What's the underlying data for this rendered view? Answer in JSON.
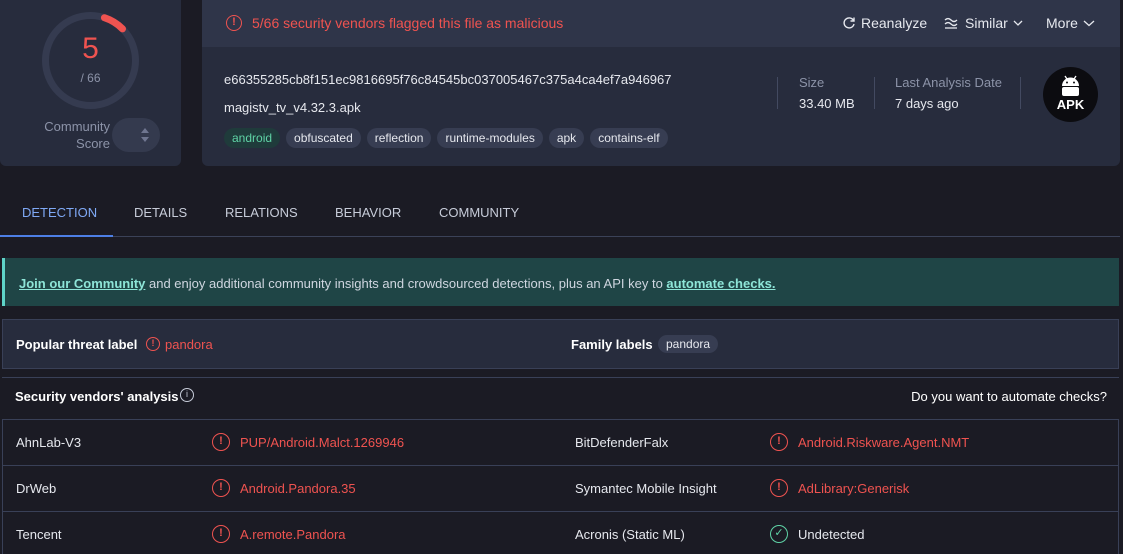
{
  "score": {
    "detections": "5",
    "total": "/ 66",
    "fraction": 0.076,
    "community_label_1": "Community",
    "community_label_2": "Score"
  },
  "header": {
    "alert": "5/66 security vendors flagged this file as malicious",
    "actions": [
      "Reanalyze",
      "Similar",
      "More"
    ],
    "hash": "e66355285cb8f151ec9816695f76c84545bc037005467c375a4ca4ef7a946967",
    "file_name": "magistv_tv_v4.32.3.apk",
    "tags": [
      "android",
      "obfuscated",
      "reflection",
      "runtime-modules",
      "apk",
      "contains-elf"
    ],
    "size_label": "Size",
    "size_value": "33.40 MB",
    "date_label": "Last Analysis Date",
    "date_value": "7 days ago",
    "file_type": "APK"
  },
  "tabs": [
    "DETECTION",
    "DETAILS",
    "RELATIONS",
    "BEHAVIOR",
    "COMMUNITY"
  ],
  "banner": {
    "link1": "Join our Community",
    "text": " and enjoy additional community insights and crowdsourced detections, plus an API key to ",
    "link2": "automate checks."
  },
  "labels": {
    "popular_title": "Popular threat label",
    "popular_value": "pandora",
    "family_title": "Family labels",
    "family_value": "pandora"
  },
  "vendors": {
    "title": "Security vendors' analysis",
    "automate": "Do you want to automate checks?",
    "rows": [
      {
        "left_name": "AhnLab-V3",
        "left_result": "PUP/Android.Malct.1269946",
        "right_name": "BitDefenderFalx",
        "right_result": "Android.Riskware.Agent.NMT"
      },
      {
        "left_name": "DrWeb",
        "left_result": "Android.Pandora.35",
        "right_name": "Symantec Mobile Insight",
        "right_result": "AdLibrary:Generisk"
      },
      {
        "left_name": "Tencent",
        "left_result": "A.remote.Pandora",
        "right_name": "Acronis (Static ML)",
        "right_result": "Undetected"
      }
    ]
  },
  "colors": {
    "malicious": "#ef5350",
    "clean": "#5fd3a6",
    "accent": "#4d7fe6"
  }
}
